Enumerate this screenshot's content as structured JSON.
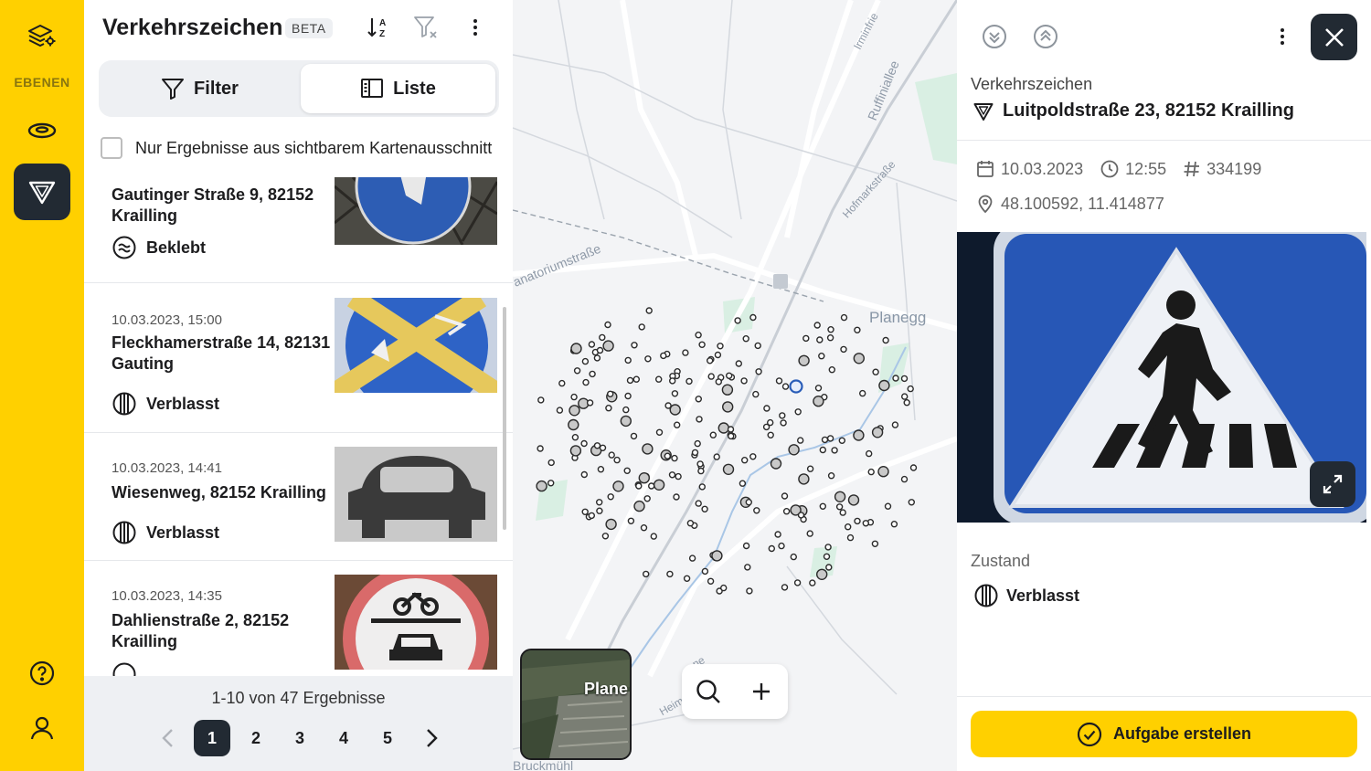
{
  "rail": {
    "layers_label": "EBENEN"
  },
  "panel": {
    "title": "Verkehrszeichen",
    "beta": "BETA",
    "tabs": {
      "filter": "Filter",
      "list": "Liste"
    },
    "checkbox_label": "Nur Ergebnisse aus sichtbarem Kartenausschnitt"
  },
  "items": [
    {
      "date": "",
      "address": "Gautinger Straße 9, 82152 Krailling",
      "status": "Beklebt"
    },
    {
      "date": "10.03.2023, 15:00",
      "address": "Fleckhamerstraße 14, 82131 Gauting",
      "status": "Verblasst"
    },
    {
      "date": "10.03.2023, 14:41",
      "address": "Wiesenweg, 82152 Krailling",
      "status": "Verblasst"
    },
    {
      "date": "10.03.2023, 14:35",
      "address": "Dahlienstraße 2, 82152 Krailling",
      "status": ""
    }
  ],
  "pagination": {
    "summary": "1-10 von 47 Ergebnisse",
    "pages": [
      "1",
      "2",
      "3",
      "4",
      "5"
    ],
    "current": "1"
  },
  "map": {
    "labels": {
      "planegg": "Planegg",
      "sanatorium": "anatoriumstraße",
      "hofmark": "Hofmarkstraße",
      "ruffini": "Ruffiniallee",
      "irmin": "Irminfrie",
      "heim": "Heim",
      "ne": "ne",
      "bruckmuehl": "Bruckmühl"
    },
    "sat_label": "Plane"
  },
  "detail": {
    "category": "Verkehrszeichen",
    "title": "Luitpoldstraße 23, 82152 Krailling",
    "date": "10.03.2023",
    "time": "12:55",
    "id": "334199",
    "coords": "48.100592, 11.414877",
    "zustand_label": "Zustand",
    "zustand_value": "Verblasst",
    "cta": "Aufgabe erstellen"
  },
  "colors": {
    "accent": "#ffd000",
    "dark": "#222a33",
    "map_bg": "#f3f4f6",
    "sign_blue": "#2a5db8"
  }
}
